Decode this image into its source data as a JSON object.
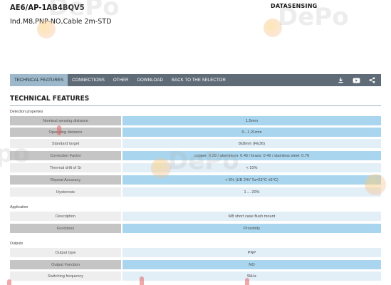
{
  "product": {
    "code": "AE6/AP-1AB4BQV5",
    "description": "Ind.M8,PNP-NO,Cable 2m-STD",
    "brand": "DATASENSING"
  },
  "nav": {
    "tabs": [
      "TECHNICAL FEATURES",
      "CONNECTIONS",
      "OTHER",
      "DOWNLOAD",
      "BACK TO THE SELECTOR"
    ],
    "active_tab": "TECHNICAL FEATURES",
    "icons": [
      "download-icon",
      "video-icon",
      "share-icon"
    ]
  },
  "section": {
    "title": "TECHNICAL FEATURES"
  },
  "groups": [
    {
      "title": "Detection properties",
      "rows": [
        {
          "label": "Nominal sensing distance",
          "value": "1.5mm"
        },
        {
          "label": "Operating distance",
          "value": "0...1.21mm"
        },
        {
          "label": "Standard target",
          "value": "8x8mm (FE36)"
        },
        {
          "label": "Correction Factor",
          "value": "copper: 0.29 / aluminium: 0.45 / brass: 0.49 / stainless steel: 0.76"
        },
        {
          "label": "Thermal drift of Sr",
          "value": "< 10%"
        },
        {
          "label": "Repeat Accuracy",
          "value": "< 5% (UB 24V Ta=23°C ±5°C)"
        },
        {
          "label": "Hysteresis",
          "value": "1 ... 20%"
        }
      ]
    },
    {
      "title": "Application",
      "rows": [
        {
          "label": "Description",
          "value": "M8 short case flush mount"
        },
        {
          "label": "Functions",
          "value": "Proximity"
        }
      ]
    },
    {
      "title": "Outputs",
      "rows": [
        {
          "label": "Output type",
          "value": "PNP"
        },
        {
          "label": "Output Function",
          "value": "NO"
        },
        {
          "label": "Switching frequency",
          "value": "5kHz"
        }
      ]
    }
  ],
  "watermark": {
    "text": "DePositphotos"
  },
  "colors": {
    "navbar": "#5f6c77",
    "active_tab": "#9db8cb",
    "label_cell": "#c5c5c5",
    "value_cell": "#a9d6ee"
  }
}
